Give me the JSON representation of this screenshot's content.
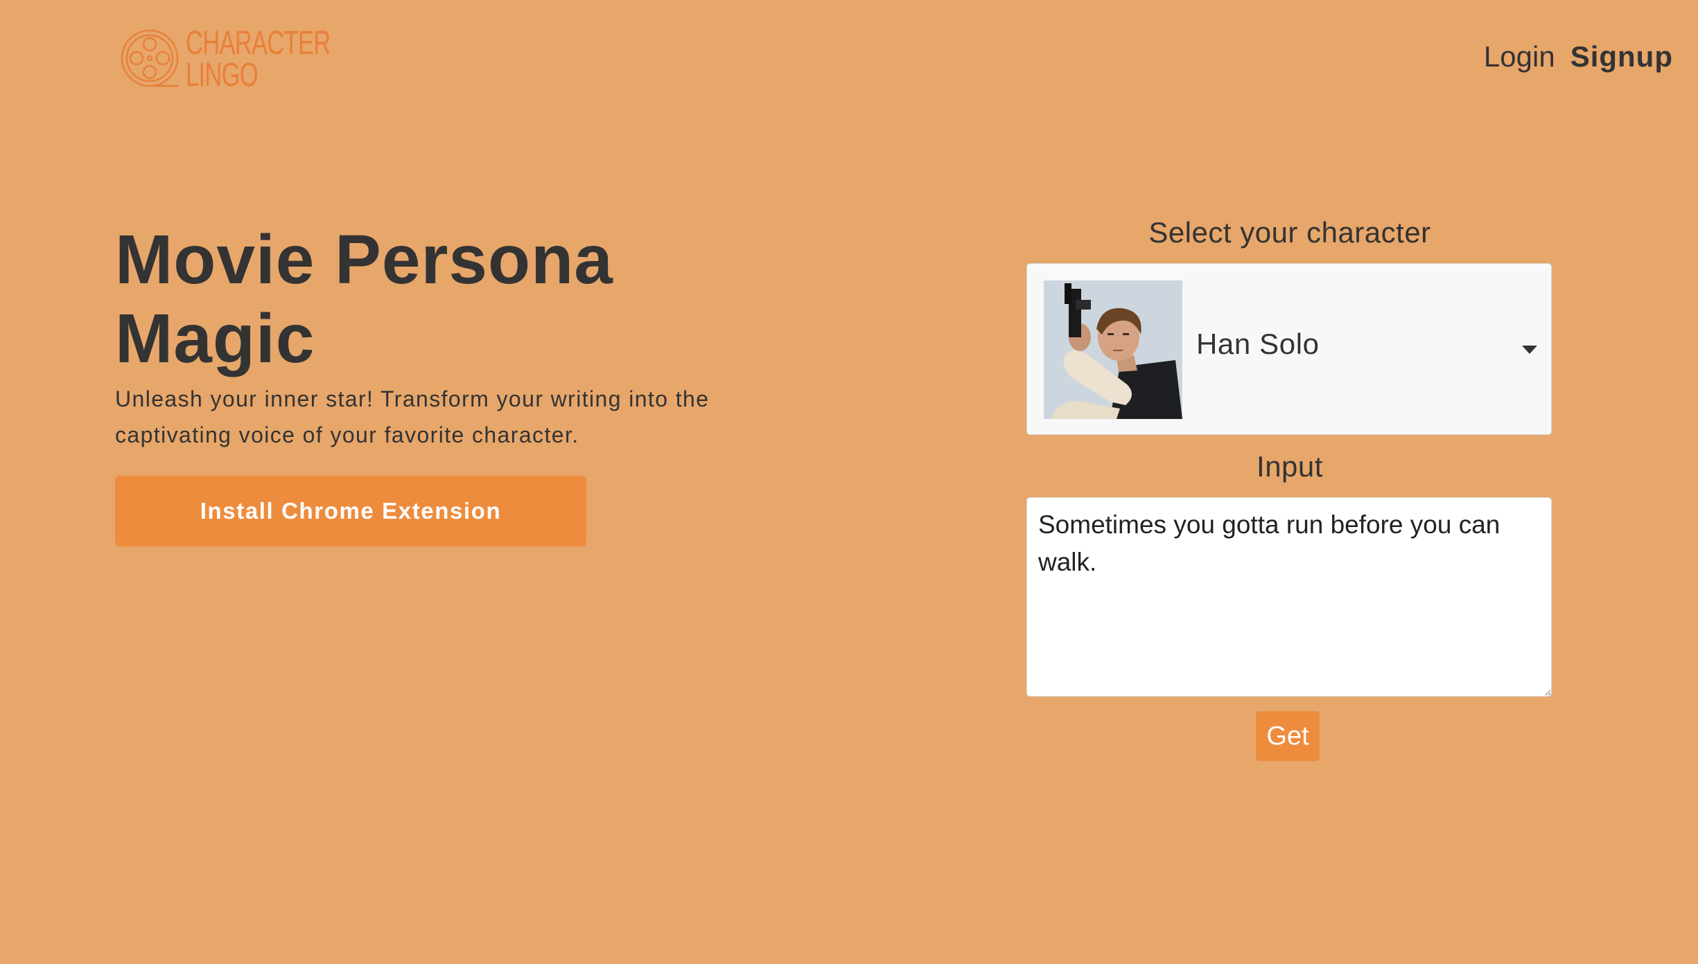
{
  "header": {
    "logo_line1": "CHARACTER",
    "logo_line2": "LINGO",
    "login_label": "Login",
    "signup_label": "Signup"
  },
  "hero": {
    "title": "Movie Persona Magic",
    "subtitle": "Unleash your inner star! Transform your writing into the captivating voice of your favorite character.",
    "install_button_label": "Install Chrome Extension"
  },
  "form": {
    "character_label": "Select your character",
    "selected_character": "Han Solo",
    "input_label": "Input",
    "input_value": "Sometimes you gotta run before you can walk.",
    "submit_label": "Get"
  },
  "icons": {
    "logo": "film-reel-icon",
    "dropdown": "caret-down-icon"
  },
  "colors": {
    "background": "#e7a66a",
    "accent": "#ee8c3e",
    "logo": "#e8803a",
    "text": "#333333"
  }
}
